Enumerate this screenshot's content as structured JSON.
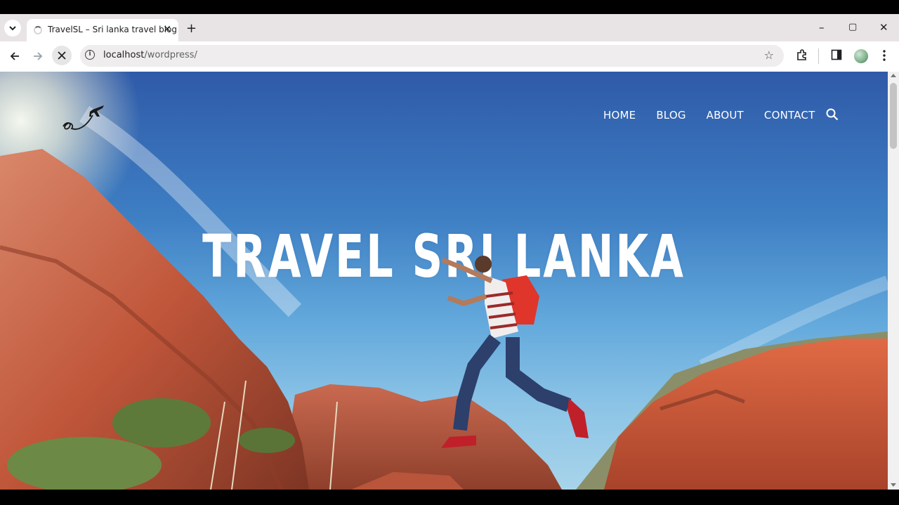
{
  "browser": {
    "tab_title": "TravelSL – Sri lanka travel blog",
    "new_tab_symbol": "+",
    "close_symbol": "✕",
    "url_host": "localhost",
    "url_path": "/wordpress/",
    "window_controls": {
      "minimize": "–",
      "maximize": "▢",
      "close": "✕"
    },
    "icons": [
      "tab-search-icon",
      "back-icon",
      "forward-icon",
      "reload-icon",
      "site-info-icon",
      "bookmark-star-icon",
      "extensions-icon",
      "side-panel-icon",
      "profile-avatar",
      "menu-icon"
    ]
  },
  "site": {
    "logo_icon": "airplane-loop-logo",
    "nav": {
      "items": [
        {
          "label": "HOME"
        },
        {
          "label": "BLOG"
        },
        {
          "label": "ABOUT"
        },
        {
          "label": "CONTACT"
        }
      ],
      "search_icon": "search-icon"
    },
    "hero": {
      "title": "TRAVEL SRI LANKA",
      "background": "photo of hiker jumping between red rocks under blue sky"
    }
  },
  "colors": {
    "sky_top": "#2f5aa8",
    "sky_bottom": "#a8d4ea",
    "rock": "#c5532f",
    "tab_strip": "#e8e3e4",
    "text_white": "#ffffff"
  }
}
